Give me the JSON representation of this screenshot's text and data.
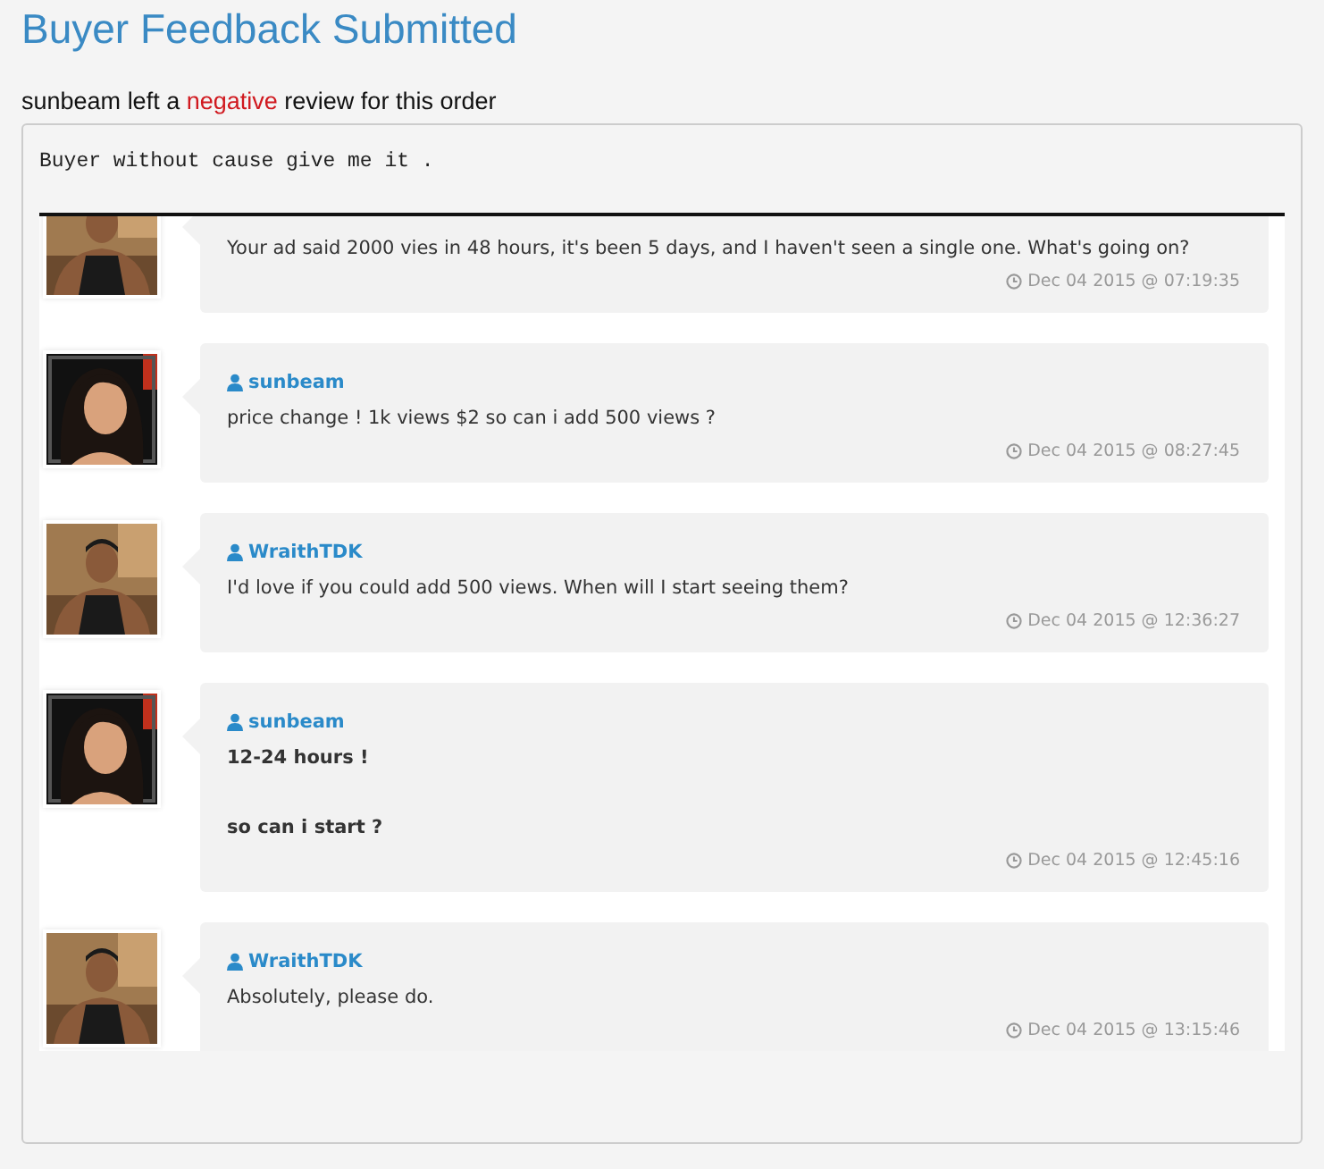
{
  "title": "Buyer Feedback Submitted",
  "summary": {
    "buyer": "sunbeam",
    "before": "left a",
    "rating": "negative",
    "after": "review for this order"
  },
  "comment": "Buyer without cause give me it .",
  "messages": [
    {
      "avatar": {
        "kind": "picture"
      },
      "lines": [
        "Your ad said 2000 vies in 48 hours, it's been 5 days, and I haven't seen a single one. What's going on?"
      ],
      "bold": false,
      "time": "Dec 04 2015 @ 07:19:35"
    },
    {
      "avatar": {
        "kind": "picture"
      },
      "author": "sunbeam",
      "lines": [
        "price change ! 1k views $2 so can i add 500 views ?"
      ],
      "bold": false,
      "time": "Dec 04 2015 @ 08:27:45"
    },
    {
      "avatar": {
        "kind": "picture"
      },
      "author": "WraithTDK",
      "lines": [
        "I'd love if you could add 500 views. When will I start seeing them?"
      ],
      "bold": false,
      "time": "Dec 04 2015 @ 12:36:27"
    },
    {
      "avatar": {
        "kind": "picture"
      },
      "author": "sunbeam",
      "lines": [
        "12-24 hours !",
        "so can i start ?"
      ],
      "bold": true,
      "time": "Dec 04 2015 @ 12:45:16"
    },
    {
      "avatar": {
        "kind": "picture"
      },
      "author": "WraithTDK",
      "lines": [
        "Absolutely, please do."
      ],
      "bold": false,
      "time": "Dec 04 2015 @ 13:15:46"
    }
  ]
}
